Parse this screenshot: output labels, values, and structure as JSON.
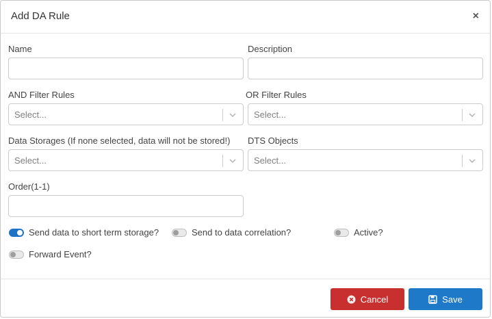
{
  "modal": {
    "title": "Add DA Rule",
    "close_glyph": "×"
  },
  "fields": {
    "name": {
      "label": "Name",
      "value": ""
    },
    "description": {
      "label": "Description",
      "value": ""
    },
    "and_filter": {
      "label": "AND Filter Rules",
      "placeholder": "Select..."
    },
    "or_filter": {
      "label": "OR Filter Rules",
      "placeholder": "Select..."
    },
    "data_storages": {
      "label": "Data Storages (If none selected, data will not be stored!)",
      "placeholder": "Select..."
    },
    "dts_objects": {
      "label": "DTS Objects",
      "placeholder": "Select..."
    },
    "order": {
      "label": "Order(1-1)",
      "value": ""
    }
  },
  "toggles": {
    "short_term": {
      "label": "Send data to short term storage?",
      "on": true
    },
    "correlation": {
      "label": "Send to data correlation?",
      "on": false
    },
    "active": {
      "label": "Active?",
      "on": false
    },
    "forward": {
      "label": "Forward Event?",
      "on": false
    }
  },
  "footer": {
    "cancel_label": "Cancel",
    "save_label": "Save"
  },
  "colors": {
    "accent": "#1e73c4",
    "cancel": "#c7302f",
    "save": "#1f79c9"
  },
  "icons": {
    "cancel": "x-circle-icon",
    "save": "floppy-disk-icon",
    "select": "chevron-down-icon"
  }
}
